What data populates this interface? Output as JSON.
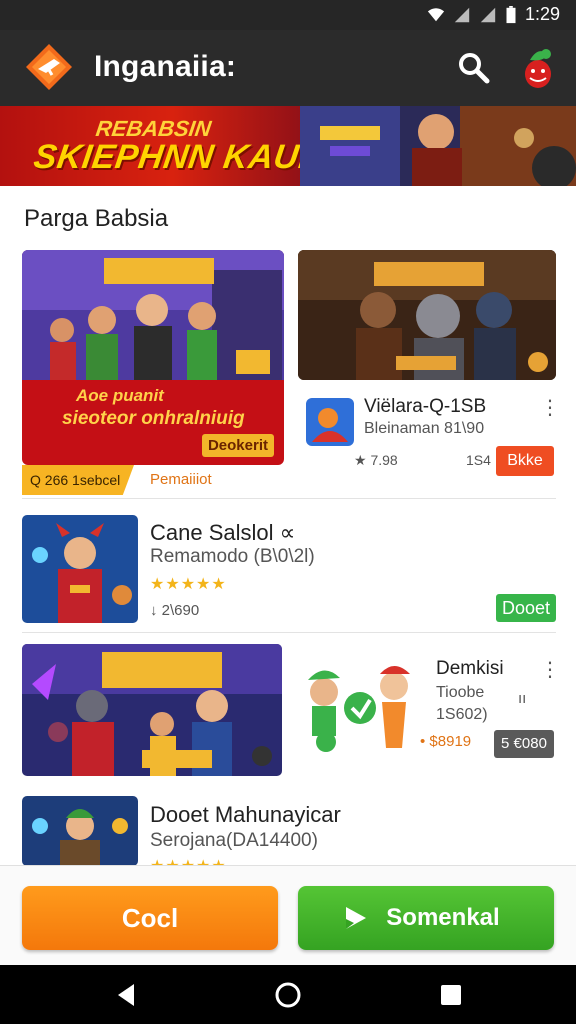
{
  "status_bar": {
    "time": "1:29"
  },
  "app_bar": {
    "title": "Inganaiia:",
    "logo_icon": "app-logo-icon",
    "search_icon": "search-icon",
    "avatar_icon": "avatar-icon"
  },
  "banner": {
    "subtitle": "REBABSIN",
    "title": "SKIEPHNN KAUIS"
  },
  "section": {
    "title": "Parga Babsia"
  },
  "featured": {
    "left": {
      "caption_line1": "Aoe puanit",
      "caption_line2": "sieoteor onhralniuig",
      "badge": "Deokerit",
      "meta_pill": "Q 266 1sebcel",
      "meta_text": "Pemaiiiot"
    },
    "right": {
      "title": "Viëlara-Q-1SB",
      "subtitle": "Bleinaman 81\\90",
      "rating": "★ 7.98",
      "size": "1S4",
      "button": "Bkke"
    }
  },
  "list": [
    {
      "title": "Cane Salslol ∝",
      "subtitle": "Remamodo (B\\0\\2l)",
      "stars": "★★★★★",
      "meta": "↓ 2\\690",
      "button": "Dooet"
    },
    {
      "title": "Demkisi",
      "line2": "Tioobe",
      "line3": "1S602)",
      "side": "ıı",
      "price": "• $8919",
      "button": "5 €080"
    },
    {
      "title": "Dooet Mahunayicar",
      "subtitle": "Serojana(DA14400)",
      "stars": "★★★★★"
    }
  ],
  "actions": {
    "primary": "Cocl",
    "secondary": "Somenkal"
  },
  "colors": {
    "accent_orange": "#f4780b",
    "accent_green": "#37b54a",
    "accent_red": "#ef4d22",
    "app_bar": "#2b2b2b"
  }
}
